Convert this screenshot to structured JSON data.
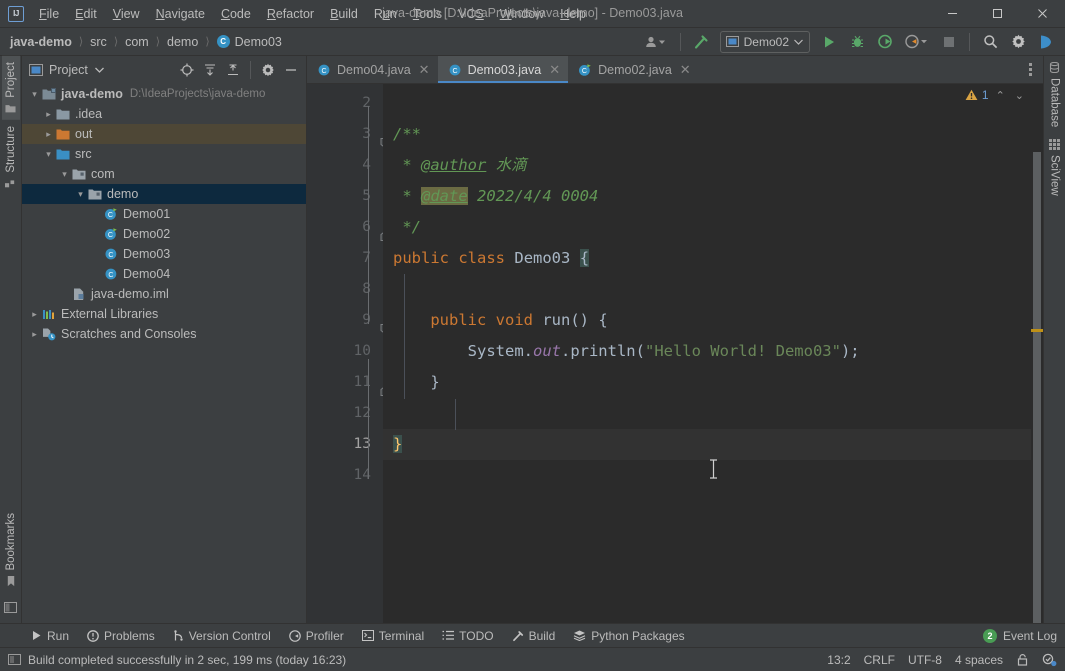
{
  "window": {
    "title": "java-demo [D:\\IdeaProjects\\java-demo] - Demo03.java",
    "logo": "IJ",
    "minimize": "minimize-icon",
    "maximize": "maximize-icon",
    "close": "close-icon"
  },
  "menubar": [
    {
      "label": "File",
      "mnemonic": "F"
    },
    {
      "label": "Edit",
      "mnemonic": "E"
    },
    {
      "label": "View",
      "mnemonic": "V"
    },
    {
      "label": "Navigate",
      "mnemonic": "N"
    },
    {
      "label": "Code",
      "mnemonic": "C"
    },
    {
      "label": "Refactor",
      "mnemonic": "R"
    },
    {
      "label": "Build",
      "mnemonic": "B"
    },
    {
      "label": "Run",
      "mnemonic": "u"
    },
    {
      "label": "Tools",
      "mnemonic": "T"
    },
    {
      "label": "VCS",
      "mnemonic": "S"
    },
    {
      "label": "Window",
      "mnemonic": "W"
    },
    {
      "label": "Help",
      "mnemonic": "H"
    }
  ],
  "breadcrumb": {
    "items": [
      "java-demo",
      "src",
      "com",
      "demo",
      "Demo03"
    ],
    "separator": "〉",
    "last_icon": "java-class-icon"
  },
  "navbar_actions": {
    "user_icon": "user-dropdown-icon",
    "build_hammer": "build-hammer-icon",
    "run_config": "Demo02",
    "run_config_icon": "run-config-icon",
    "run": "run-icon",
    "debug": "debug-icon",
    "run_coverage": "run-with-coverage-icon",
    "profiler": "profiler-icon",
    "stop": "stop-icon",
    "search": "search-everywhere-icon",
    "settings": "settings-gear-icon",
    "updates": "ide-updates-icon"
  },
  "left_strip": {
    "tabs": [
      {
        "label": "Project",
        "icon": "project-folder-icon",
        "active": true
      },
      {
        "label": "Structure",
        "icon": "structure-icon",
        "active": false
      },
      {
        "label": "Bookmarks",
        "icon": "bookmark-icon",
        "active": false
      }
    ],
    "bottom_icon": "terminal-panel-icon"
  },
  "right_strip": {
    "tabs": [
      {
        "label": "Database",
        "icon": "database-icon"
      },
      {
        "label": "SciView",
        "icon": "sciview-grid-icon"
      }
    ]
  },
  "project_panel": {
    "title": "Project",
    "title_icon": "project-view-icon",
    "dropdown_icon": "chevron-down-icon",
    "tools": [
      "locate-target-icon",
      "expand-all-icon",
      "collapse-all-icon",
      "settings-gear-icon",
      "hide-panel-icon"
    ],
    "tree": [
      {
        "label": "java-demo",
        "sub": "D:\\IdeaProjects\\java-demo",
        "indent": 0,
        "arrow": "expanded",
        "icon": "module-folder-icon",
        "bold": true,
        "state": "normal"
      },
      {
        "label": ".idea",
        "sub": "",
        "indent": 1,
        "arrow": "collapsed",
        "icon": "folder-icon",
        "bold": false,
        "state": "normal"
      },
      {
        "label": "out",
        "sub": "",
        "indent": 1,
        "arrow": "collapsed",
        "icon": "folder-orange-icon",
        "bold": false,
        "state": "highlight"
      },
      {
        "label": "src",
        "sub": "",
        "indent": 1,
        "arrow": "expanded",
        "icon": "source-folder-icon",
        "bold": false,
        "state": "normal"
      },
      {
        "label": "com",
        "sub": "",
        "indent": 2,
        "arrow": "expanded",
        "icon": "package-icon",
        "bold": false,
        "state": "normal"
      },
      {
        "label": "demo",
        "sub": "",
        "indent": 3,
        "arrow": "expanded",
        "icon": "package-icon",
        "bold": false,
        "state": "selected"
      },
      {
        "label": "Demo01",
        "sub": "",
        "indent": 4,
        "arrow": "none",
        "icon": "java-runnable-class-icon",
        "bold": false,
        "state": "normal"
      },
      {
        "label": "Demo02",
        "sub": "",
        "indent": 4,
        "arrow": "none",
        "icon": "java-runnable-class-icon",
        "bold": false,
        "state": "normal"
      },
      {
        "label": "Demo03",
        "sub": "",
        "indent": 4,
        "arrow": "none",
        "icon": "java-class-icon",
        "bold": false,
        "state": "normal"
      },
      {
        "label": "Demo04",
        "sub": "",
        "indent": 4,
        "arrow": "none",
        "icon": "java-class-icon",
        "bold": false,
        "state": "normal"
      },
      {
        "label": "java-demo.iml",
        "sub": "",
        "indent": 2,
        "arrow": "none",
        "icon": "iml-file-icon",
        "bold": false,
        "state": "normal"
      },
      {
        "label": "External Libraries",
        "sub": "",
        "indent": 0,
        "arrow": "collapsed",
        "icon": "libraries-icon",
        "bold": false,
        "state": "normal"
      },
      {
        "label": "Scratches and Consoles",
        "sub": "",
        "indent": 0,
        "arrow": "collapsed",
        "icon": "scratches-icon",
        "bold": false,
        "state": "normal"
      }
    ]
  },
  "editor": {
    "tabs": [
      {
        "label": "Demo04.java",
        "icon": "java-class-icon",
        "active": false
      },
      {
        "label": "Demo03.java",
        "icon": "java-class-icon",
        "active": true
      },
      {
        "label": "Demo02.java",
        "icon": "java-runnable-class-icon",
        "active": false
      }
    ],
    "tab_close_icon": "close-icon",
    "more_tabs_icon": "more-options-icon",
    "first_visible_line": 2,
    "current_line": 13,
    "lines": [
      {
        "n": 2,
        "fold": "none",
        "segments": []
      },
      {
        "n": 3,
        "fold": "open",
        "segments": [
          {
            "t": "/**",
            "c": "cmt"
          }
        ]
      },
      {
        "n": 4,
        "fold": "none",
        "segments": [
          {
            "t": " * ",
            "c": "cmt"
          },
          {
            "t": "@author",
            "c": "tag"
          },
          {
            "t": " 水滴",
            "c": "cmt"
          }
        ]
      },
      {
        "n": 5,
        "fold": "none",
        "segments": [
          {
            "t": " * ",
            "c": "cmt"
          },
          {
            "t": "@date",
            "c": "tag tag-hl"
          },
          {
            "t": " 2022/4/4 0004",
            "c": "cmt"
          }
        ]
      },
      {
        "n": 6,
        "fold": "close",
        "segments": [
          {
            "t": " */",
            "c": "cmt"
          }
        ]
      },
      {
        "n": 7,
        "fold": "none",
        "segments": [
          {
            "t": "public",
            "c": "kw"
          },
          {
            "t": " ",
            "c": ""
          },
          {
            "t": "class",
            "c": "kw"
          },
          {
            "t": " ",
            "c": ""
          },
          {
            "t": "Demo03",
            "c": "cls"
          },
          {
            "t": " ",
            "c": ""
          },
          {
            "t": "{",
            "c": "brace-hl"
          }
        ]
      },
      {
        "n": 8,
        "fold": "none",
        "segments": []
      },
      {
        "n": 9,
        "fold": "open",
        "segments": [
          {
            "t": "    ",
            "c": ""
          },
          {
            "t": "public",
            "c": "kw"
          },
          {
            "t": " ",
            "c": ""
          },
          {
            "t": "void",
            "c": "kw"
          },
          {
            "t": " ",
            "c": ""
          },
          {
            "t": "run",
            "c": "mth"
          },
          {
            "t": "() {",
            "c": ""
          }
        ]
      },
      {
        "n": 10,
        "fold": "none",
        "segments": [
          {
            "t": "        System.",
            "c": ""
          },
          {
            "t": "out",
            "c": "fld"
          },
          {
            "t": ".println(",
            "c": ""
          },
          {
            "t": "\"Hello World! Demo03\"",
            "c": "str"
          },
          {
            "t": ");",
            "c": ""
          }
        ]
      },
      {
        "n": 11,
        "fold": "close",
        "segments": [
          {
            "t": "    }",
            "c": ""
          }
        ]
      },
      {
        "n": 12,
        "fold": "none",
        "segments": []
      },
      {
        "n": 13,
        "fold": "none",
        "segments": [
          {
            "t": "}",
            "c": "brace-hl brace-y"
          }
        ]
      },
      {
        "n": 14,
        "fold": "none",
        "segments": []
      }
    ],
    "inspection": {
      "warning_icon": "warning-triangle-icon",
      "warning_count": "1",
      "prev_icon": "chevron-up-icon",
      "next_icon": "chevron-down-icon"
    }
  },
  "bottom_tools": [
    {
      "label": "Run",
      "icon": "run-icon"
    },
    {
      "label": "Problems",
      "icon": "problems-icon"
    },
    {
      "label": "Version Control",
      "icon": "version-control-icon"
    },
    {
      "label": "Profiler",
      "icon": "profiler-icon"
    },
    {
      "label": "Terminal",
      "icon": "terminal-icon"
    },
    {
      "label": "TODO",
      "icon": "todo-icon"
    },
    {
      "label": "Build",
      "icon": "build-hammer-icon"
    },
    {
      "label": "Python Packages",
      "icon": "python-packages-icon"
    }
  ],
  "event_log": {
    "label": "Event Log",
    "count": "2"
  },
  "statusbar": {
    "build_icon": "build-status-icon",
    "message": "Build completed successfully in 2 sec, 199 ms (today 16:23)",
    "caret": "13:2",
    "line_separator": "CRLF",
    "encoding": "UTF-8",
    "indent": "4 spaces",
    "lock_icon": "read-only-lock-icon",
    "inspection_icon": "inspection-level-icon"
  },
  "colors": {
    "accent": "#4a88c7",
    "selection": "#0d293e",
    "highlight_row": "#4e4736",
    "editor_bg": "#2b2b2b",
    "panel_bg": "#3c3f41",
    "gutter_bg": "#313335",
    "keyword": "#cc7832",
    "string": "#6a8759",
    "comment": "#629755",
    "field": "#9876aa",
    "brace": "#ffc66d",
    "warning": "#bf9117",
    "success": "#499c54"
  }
}
